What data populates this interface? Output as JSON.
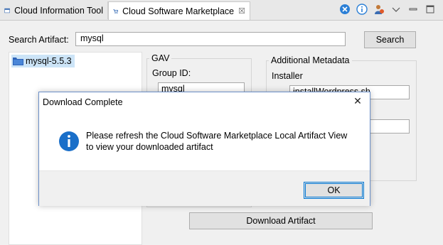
{
  "tabs": [
    {
      "label": "Cloud Information Tool"
    },
    {
      "label": "Cloud Software Marketplace",
      "close": "☒"
    }
  ],
  "search": {
    "label": "Search Artifact:",
    "value": "mysql",
    "button": "Search"
  },
  "tree": {
    "items": [
      {
        "label": "mysql-5.5.3"
      }
    ]
  },
  "gav": {
    "title": "GAV",
    "group_id_label": "Group ID:",
    "group_id_value": "mysql"
  },
  "metadata": {
    "title": "Additional Metadata",
    "installer_label": "Installer",
    "installer_value": "installWordpress.sh"
  },
  "download_button": "Download Artifact",
  "dialog": {
    "title": "Download Complete",
    "message": "Please refresh the Cloud Software Marketplace Local Artifact View to view your downloaded artifact",
    "ok": "OK",
    "close_glyph": "✕"
  },
  "colors": {
    "selection": "#cce4f7",
    "dialog_border": "#6b8fc8",
    "info_blue": "#1a6fc9",
    "focus": "#0078d7"
  }
}
